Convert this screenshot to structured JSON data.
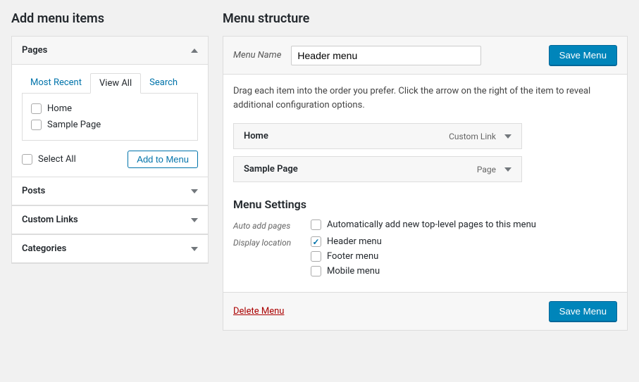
{
  "left": {
    "heading": "Add menu items",
    "sections": {
      "pages": {
        "title": "Pages",
        "tabs": [
          "Most Recent",
          "View All",
          "Search"
        ],
        "active_tab": 1,
        "items": [
          "Home",
          "Sample Page"
        ],
        "select_all": "Select All",
        "add_button": "Add to Menu"
      },
      "posts": {
        "title": "Posts"
      },
      "custom_links": {
        "title": "Custom Links"
      },
      "categories": {
        "title": "Categories"
      }
    }
  },
  "right": {
    "heading": "Menu structure",
    "menu_name_label": "Menu Name",
    "menu_name_value": "Header menu",
    "save_button": "Save Menu",
    "hint": "Drag each item into the order you prefer. Click the arrow on the right of the item to reveal additional configuration options.",
    "items": [
      {
        "title": "Home",
        "type": "Custom Link"
      },
      {
        "title": "Sample Page",
        "type": "Page"
      }
    ],
    "settings": {
      "heading": "Menu Settings",
      "auto_add_label": "Auto add pages",
      "auto_add_option": "Automatically add new top-level pages to this menu",
      "display_label": "Display location",
      "locations": [
        {
          "label": "Header menu",
          "checked": true
        },
        {
          "label": "Footer menu",
          "checked": false
        },
        {
          "label": "Mobile menu",
          "checked": false
        }
      ]
    },
    "delete_link": "Delete Menu"
  }
}
